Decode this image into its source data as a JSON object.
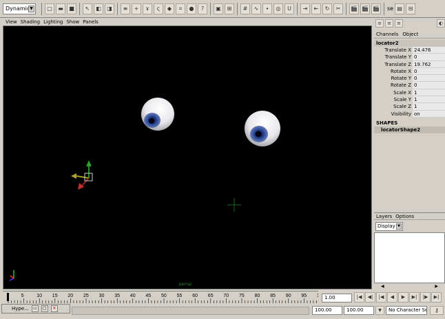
{
  "shelf": {
    "menu_set": "Dynamics",
    "more_label": "se"
  },
  "viewport": {
    "menu": [
      "View",
      "Shading",
      "Lighting",
      "Show",
      "Panels"
    ],
    "camera_label": "persp"
  },
  "channel_box": {
    "tabs": [
      "Channels",
      "Object"
    ],
    "object_name": "locator2",
    "attributes": [
      {
        "label": "Translate X",
        "value": "24.476"
      },
      {
        "label": "Translate Y",
        "value": "0"
      },
      {
        "label": "Translate Z",
        "value": "19.762"
      },
      {
        "label": "Rotate X",
        "value": "0"
      },
      {
        "label": "Rotate Y",
        "value": "0"
      },
      {
        "label": "Rotate Z",
        "value": "0"
      },
      {
        "label": "Scale X",
        "value": "1"
      },
      {
        "label": "Scale Y",
        "value": "1"
      },
      {
        "label": "Scale Z",
        "value": "1"
      },
      {
        "label": "Visibility",
        "value": "on"
      }
    ],
    "shapes_header": "SHAPES",
    "shape_name": "locatorShape2"
  },
  "layers": {
    "tabs": [
      "Layers",
      "Options"
    ],
    "mode": "Display"
  },
  "time_slider": {
    "ticks": [
      "5",
      "10",
      "15",
      "20",
      "25",
      "30",
      "35",
      "40",
      "45",
      "50",
      "55",
      "60",
      "65",
      "70",
      "75",
      "80",
      "85",
      "90",
      "95",
      "1"
    ],
    "current_time": "1.00"
  },
  "range": {
    "start": "100.00",
    "end": "100.00",
    "character_set": "No Character Set"
  },
  "taskbar": {
    "window_title": "Hype..."
  }
}
